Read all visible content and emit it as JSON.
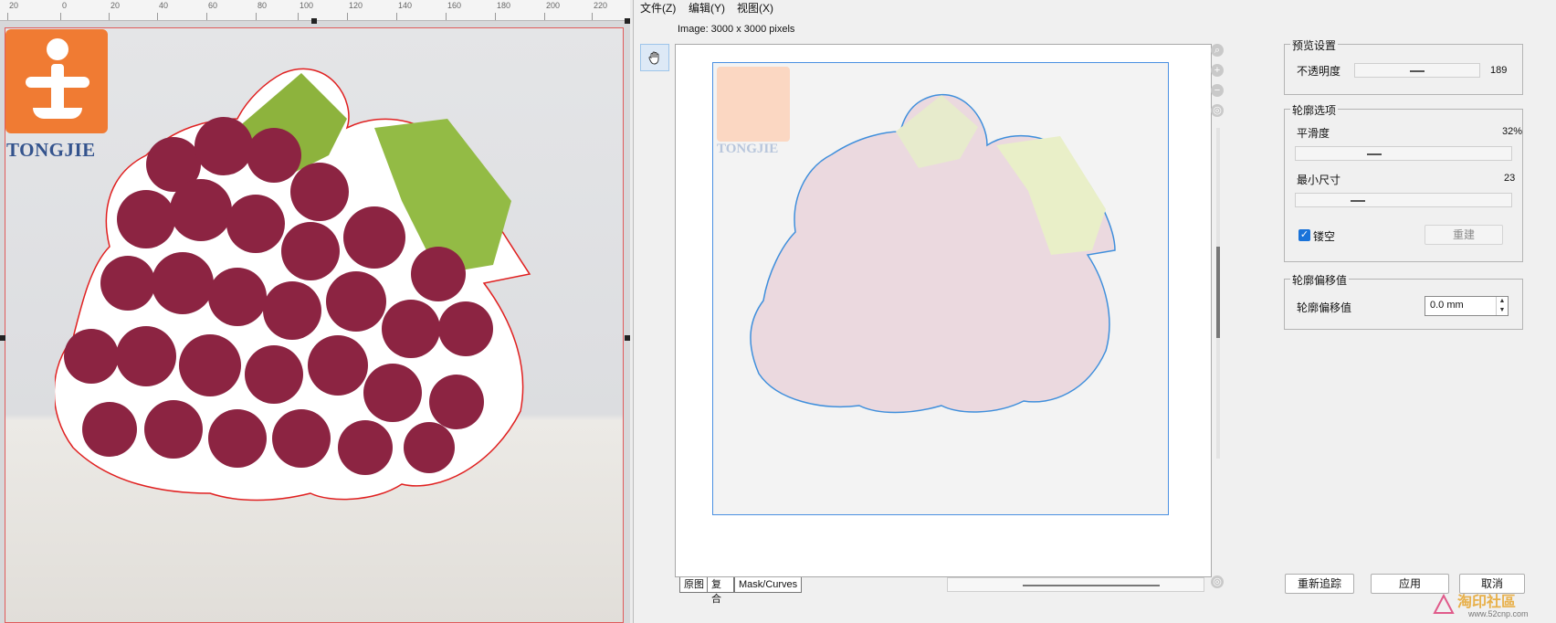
{
  "ruler": {
    "ticks": [
      "20",
      "0",
      "20",
      "40",
      "60",
      "80",
      "100",
      "120",
      "140",
      "160",
      "180",
      "200",
      "220"
    ]
  },
  "canvas": {
    "logo_text": "TONGJIE"
  },
  "dialog": {
    "menu": {
      "file": "文件(Z)",
      "edit": "编辑(Y)",
      "view": "视图(X)"
    },
    "image_info": "Image: 3000 x 3000 pixels",
    "preview_brand": "TONGJIE",
    "tabs": {
      "original": "原图",
      "composite": "复合",
      "mask": "Mask/Curves"
    },
    "preview_settings": {
      "title": "预览设置",
      "opacity_label": "不透明度",
      "opacity_value": "189"
    },
    "contour_options": {
      "title": "轮廓选项",
      "smoothness_label": "平滑度",
      "smoothness_value": "32%",
      "min_size_label": "最小尺寸",
      "min_size_value": "23",
      "hollow_label": "镂空",
      "rebuild_label": "重建"
    },
    "offset": {
      "title": "轮廓偏移值",
      "label": "轮廓偏移值",
      "value": "0.0 mm"
    },
    "buttons": {
      "retrace": "重新追踪",
      "apply": "应用",
      "cancel": "取消"
    },
    "watermark": {
      "name": "淘印社區",
      "url": "www.52cnp.com"
    }
  }
}
